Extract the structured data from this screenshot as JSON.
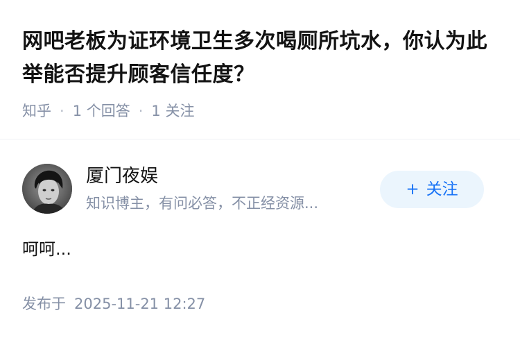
{
  "question": {
    "title": "网吧老板为证环境卫生多次喝厕所坑水，你认为此举能否提升顾客信任度？",
    "source": "知乎",
    "answer_count": "1 个回答",
    "follower_count": "1 关注"
  },
  "author": {
    "name": "厦门夜娱",
    "bio": "知识博主，有问必答，不正经资源..."
  },
  "follow_button": {
    "plus_symbol": "+",
    "label": "关注"
  },
  "answer": {
    "content": "呵呵..."
  },
  "publish": {
    "prefix": "发布于",
    "time": "2025-11-21 12:27"
  },
  "colors": {
    "accent": "#1772f6",
    "follow_bg": "#ebf5fd",
    "meta_text": "#8590a6",
    "title_text": "#121212"
  }
}
